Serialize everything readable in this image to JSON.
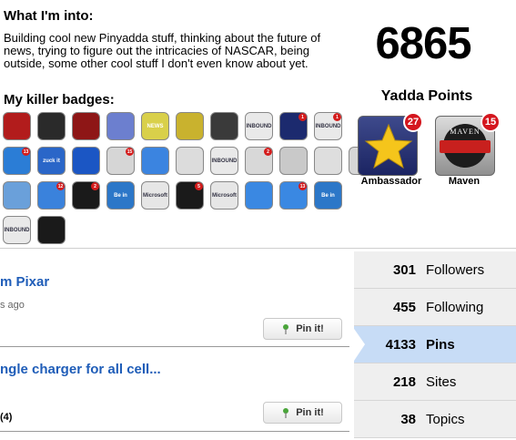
{
  "profile": {
    "into_heading": "What I'm into:",
    "about": "Building cool new Pinyadda stuff, thinking about the future of news, trying to figure out the intricacies of NASCAR, being outside, some other cool stuff I don't even know about yet.",
    "badges_heading": "My killer badges:"
  },
  "points": {
    "value": "6865",
    "label": "Yadda Points"
  },
  "featured_badges": [
    {
      "label": "Ambassador",
      "count": "27",
      "icon": "star-icon"
    },
    {
      "label": "Maven",
      "count": "15",
      "icon": "maven-ribbon-icon",
      "emblem_text": "MAVEN"
    }
  ],
  "badges": [
    {
      "text": "",
      "color": "#b21c1c",
      "count": ""
    },
    {
      "text": "",
      "color": "#2a2a2a",
      "count": ""
    },
    {
      "text": "",
      "color": "#8e1616",
      "count": ""
    },
    {
      "text": "",
      "color": "#6c7fcf",
      "count": ""
    },
    {
      "text": "NEWS",
      "color": "#d9d04a",
      "count": ""
    },
    {
      "text": "",
      "color": "#c9b22e",
      "count": ""
    },
    {
      "text": "",
      "color": "#3a3a3a",
      "count": ""
    },
    {
      "text": "INBOUND",
      "color": "#e9e9e9",
      "count": ""
    },
    {
      "text": "",
      "color": "#1c2a6e",
      "count": "1"
    },
    {
      "text": "INBOUND",
      "color": "#e9e9e9",
      "count": "1"
    },
    {
      "text": "",
      "color": "#2b7dd6",
      "count": "13"
    },
    {
      "text": "zuck it",
      "color": "#2a66c8",
      "count": ""
    },
    {
      "text": "",
      "color": "#1b56c4",
      "count": ""
    },
    {
      "text": "",
      "color": "#d6d6d6",
      "count": "15"
    },
    {
      "text": "",
      "color": "#3b84e0",
      "count": ""
    },
    {
      "text": "",
      "color": "#dcdcdc",
      "count": ""
    },
    {
      "text": "INBOUND",
      "color": "#e9e9e9",
      "count": ""
    },
    {
      "text": "",
      "color": "#d8d8d8",
      "count": "2"
    },
    {
      "text": "",
      "color": "#c9c9c9",
      "count": ""
    },
    {
      "text": "",
      "color": "#dedede",
      "count": ""
    },
    {
      "text": "",
      "color": "#d6d6d6",
      "count": ""
    },
    {
      "text": "",
      "color": "#6aa0da",
      "count": ""
    },
    {
      "text": "",
      "color": "#3a82dc",
      "count": "12"
    },
    {
      "text": "",
      "color": "#1a1a1a",
      "count": "2"
    },
    {
      "text": "Be in",
      "color": "#2c77c8",
      "count": ""
    },
    {
      "text": "Microsoft",
      "color": "#e6e6e6",
      "count": ""
    },
    {
      "text": "",
      "color": "#1a1a1a",
      "count": "5"
    },
    {
      "text": "Microsoft",
      "color": "#e6e6e6",
      "count": ""
    },
    {
      "text": "",
      "color": "#3a88e2",
      "count": ""
    },
    {
      "text": "",
      "color": "#3a88e2",
      "count": "13"
    },
    {
      "text": "Be in",
      "color": "#2c77c8",
      "count": ""
    },
    {
      "text": "INBOUND",
      "color": "#e9e9e9",
      "count": ""
    },
    {
      "text": "",
      "color": "#1a1a1a",
      "count": ""
    }
  ],
  "feed": [
    {
      "title": "m Pixar",
      "meta": "s ago",
      "pin_label": "Pin it!"
    },
    {
      "title": "ngle charger for all cell...",
      "meta": "(4)",
      "pin_label": "Pin it!"
    }
  ],
  "stats": [
    {
      "value": "301",
      "label": "Followers",
      "active": false
    },
    {
      "value": "455",
      "label": "Following",
      "active": false
    },
    {
      "value": "4133",
      "label": "Pins",
      "active": true
    },
    {
      "value": "218",
      "label": "Sites",
      "active": false
    },
    {
      "value": "38",
      "label": "Topics",
      "active": false
    }
  ]
}
